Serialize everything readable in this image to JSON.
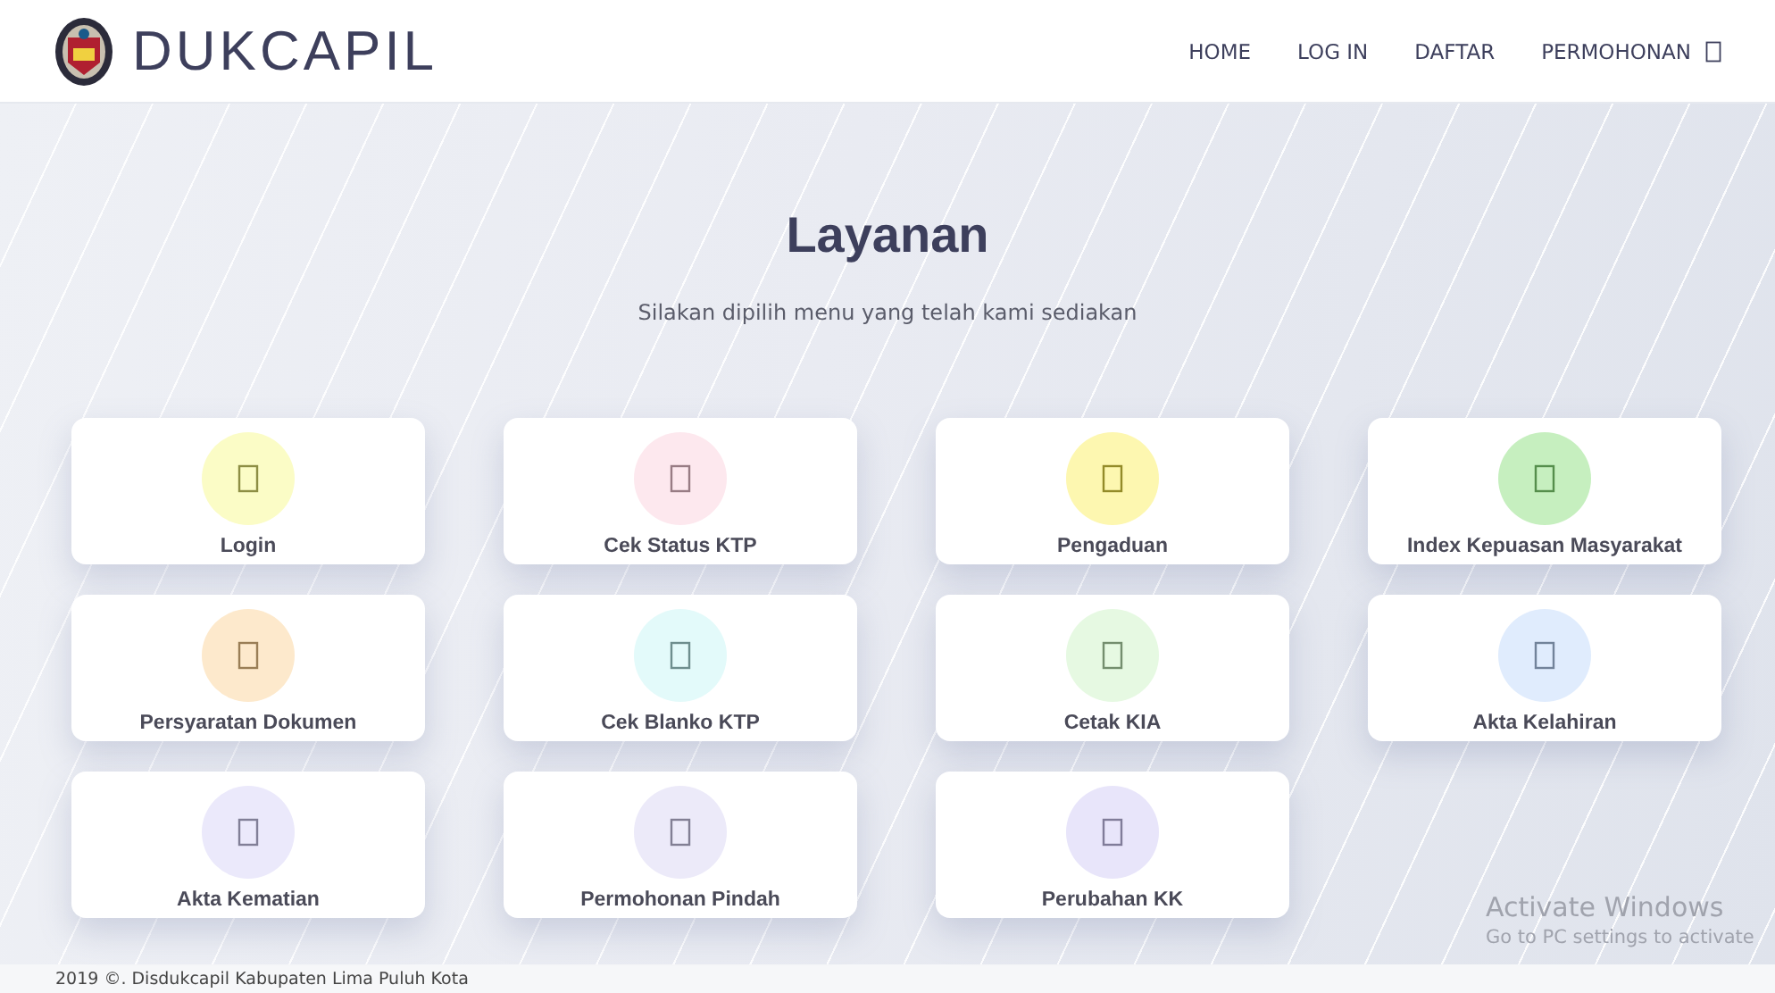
{
  "header": {
    "brand": "DUKCAPIL",
    "nav": [
      {
        "label": "HOME"
      },
      {
        "label": "LOG IN"
      },
      {
        "label": "DAFTAR"
      },
      {
        "label": "PERMOHONAN",
        "dropdown": true
      }
    ]
  },
  "hero": {
    "title": "Layanan",
    "subtitle": "Silakan dipilih menu yang telah kami sediakan"
  },
  "services": [
    {
      "label": "Login",
      "color": "#fbfcc6"
    },
    {
      "label": "Cek Status KTP",
      "color": "#fde8ee"
    },
    {
      "label": "Pengaduan",
      "color": "#fdf7b0"
    },
    {
      "label": "Index Kepuasan Masyarakat",
      "color": "#c6efbf"
    },
    {
      "label": "Persyaratan Dokumen",
      "color": "#fde9cc"
    },
    {
      "label": "Cek Blanko KTP",
      "color": "#e3fafa"
    },
    {
      "label": "Cetak KIA",
      "color": "#e6f9e2"
    },
    {
      "label": "Akta Kelahiran",
      "color": "#e0ecfd"
    },
    {
      "label": "Akta Kematian",
      "color": "#ebe9fb"
    },
    {
      "label": "Permohonan Pindah",
      "color": "#eceaf9"
    },
    {
      "label": "Perubahan KK",
      "color": "#e8e5fa"
    }
  ],
  "os_notice": {
    "title": "Activate Windows",
    "message": "Go to PC settings to activate"
  },
  "footer": {
    "text": "2019 ©. Disdukcapil Kabupaten Lima Puluh Kota"
  }
}
